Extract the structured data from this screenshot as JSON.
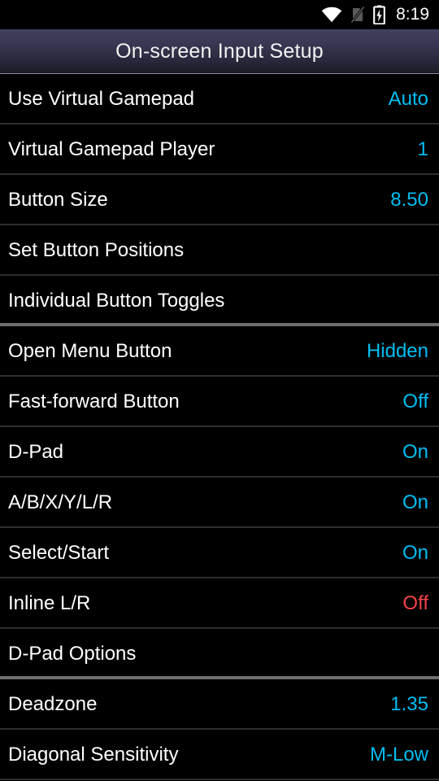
{
  "status_bar": {
    "icons": [
      {
        "name": "wifi-icon",
        "label": "wifi"
      },
      {
        "name": "no-sim-icon",
        "label": "no-sim"
      },
      {
        "name": "battery-charging-icon",
        "label": "battery-charging"
      }
    ],
    "clock": "8:19"
  },
  "title_bar": {
    "title": "On-screen Input Setup"
  },
  "colors": {
    "accent": "#00bdf2",
    "off": "#f4434a",
    "title_text": "#f2f2f2",
    "label_text": "#ffffff",
    "background": "#000000",
    "divider": "#2e2e2e",
    "section_divider": "#6e6e6e"
  },
  "preferences": [
    {
      "title": "Use Virtual Gamepad",
      "value": "Auto",
      "value_state": "normal",
      "section_break_after": false
    },
    {
      "title": "Virtual Gamepad Player",
      "value": "1",
      "value_state": "normal",
      "section_break_after": false
    },
    {
      "title": "Button Size",
      "value": "8.50",
      "value_state": "normal",
      "section_break_after": false
    },
    {
      "title": "Set Button Positions",
      "value": "",
      "value_state": "none",
      "section_break_after": false
    },
    {
      "title": "Individual Button Toggles",
      "value": "",
      "value_state": "none",
      "section_break_after": true
    },
    {
      "title": "Open Menu Button",
      "value": "Hidden",
      "value_state": "normal",
      "section_break_after": false
    },
    {
      "title": "Fast-forward Button",
      "value": "Off",
      "value_state": "normal",
      "section_break_after": false
    },
    {
      "title": "D-Pad",
      "value": "On",
      "value_state": "normal",
      "section_break_after": false
    },
    {
      "title": "A/B/X/Y/L/R",
      "value": "On",
      "value_state": "normal",
      "section_break_after": false
    },
    {
      "title": "Select/Start",
      "value": "On",
      "value_state": "normal",
      "section_break_after": false
    },
    {
      "title": "Inline L/R",
      "value": "Off",
      "value_state": "off",
      "section_break_after": false
    },
    {
      "title": "D-Pad Options",
      "value": "",
      "value_state": "none",
      "section_break_after": true
    },
    {
      "title": "Deadzone",
      "value": "1.35",
      "value_state": "normal",
      "section_break_after": false
    },
    {
      "title": "Diagonal Sensitivity",
      "value": "M-Low",
      "value_state": "normal",
      "section_break_after": false
    }
  ]
}
